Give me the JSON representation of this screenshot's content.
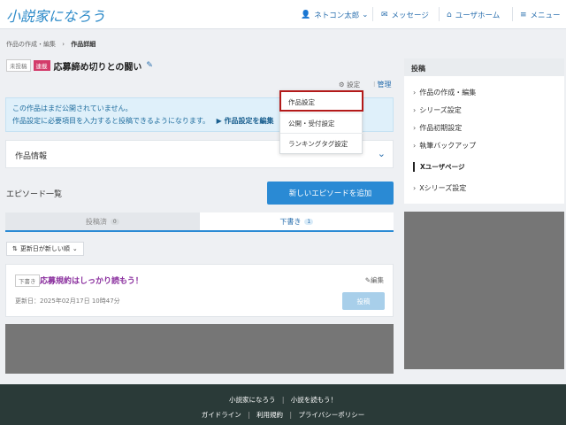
{
  "header": {
    "logo": "小説家になろう",
    "user_name": "ネトコン太郎",
    "user_caret": "⌄",
    "messages": "メッセージ",
    "user_home": "ユーザホーム",
    "menu": "メニュー"
  },
  "breadcrumb": {
    "items": [
      "作品の作成・編集",
      "作品詳細"
    ],
    "separator": "›"
  },
  "work": {
    "status_badge": "未投稿",
    "type_badge": "連載",
    "title": "応募締め切りとの闘い"
  },
  "toolbar": {
    "settings_label": "設定",
    "manage_label": "管理"
  },
  "settings_menu": {
    "items": [
      "作品設定",
      "公開・受付設定",
      "ランキングタグ設定"
    ]
  },
  "notice": {
    "line1": "この作品はまだ公開されていません。",
    "line2": "作品設定に必要項目を入力すると投稿できるようになります。",
    "link": "▶ 作品設定を編集"
  },
  "info_panel": {
    "label": "作品情報"
  },
  "episodes": {
    "heading": "エピソード一覧",
    "add_button": "新しいエピソードを追加",
    "tabs": [
      {
        "label": "投稿済",
        "count": "0"
      },
      {
        "label": "下書き",
        "count": "1"
      }
    ],
    "sort_label": "更新日が新しい順",
    "items": [
      {
        "status": "下書き",
        "title": "応募規約はしっかり読もう！",
        "edit": "編集",
        "updated": "更新日：2025年02月17日 10時47分",
        "post": "投稿"
      }
    ]
  },
  "sidebar": {
    "heading": "投稿",
    "items": [
      "作品の作成・編集",
      "シリーズ設定",
      "作品初期設定",
      "執筆バックアップ"
    ],
    "section": "Xユーザページ",
    "section_items": [
      "Xシリーズ設定"
    ]
  },
  "footer": {
    "row1": [
      "小説家になろう",
      "小説を読もう！"
    ],
    "row2": [
      "ガイドライン",
      "利用規約",
      "プライバシーポリシー"
    ]
  },
  "colors": {
    "accent": "#2a8ad4",
    "link": "#2a6fae",
    "highlight": "#b31a1a",
    "footer_bg": "#2a3a38"
  }
}
